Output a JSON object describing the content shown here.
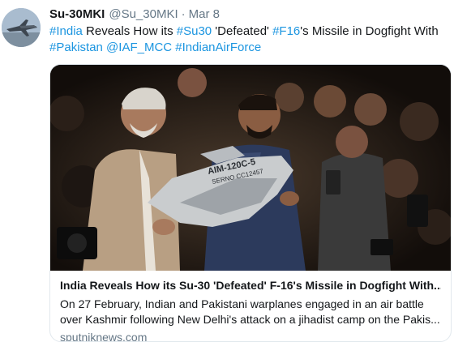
{
  "tweet": {
    "display_name": "Su-30MKI",
    "handle": "@Su_30MKI",
    "separator": "·",
    "time": "Mar 8",
    "text_segments": [
      {
        "text": "#India",
        "link": true
      },
      {
        "text": " Reveals How its ",
        "link": false
      },
      {
        "text": "#Su30",
        "link": true
      },
      {
        "text": " 'Defeated' ",
        "link": false
      },
      {
        "text": "#F16",
        "link": true
      },
      {
        "text": "'s Missile in Dogfight With ",
        "link": false
      },
      {
        "text": "#Pakistan",
        "link": true
      },
      {
        "text": " ",
        "link": false
      },
      {
        "text": "@IAF_MCC",
        "link": true
      },
      {
        "text": " ",
        "link": false
      },
      {
        "text": "#IndianAirForce",
        "link": true
      }
    ]
  },
  "card": {
    "image_text_line1": "AIM-120C-5",
    "image_text_line2": "SERNO CC12457",
    "title": "India Reveals How its Su-30 'Defeated' F-16's Missile in Dogfight With...",
    "desc_line1": "On 27 February, Indian and Pakistani warplanes engaged in an air battle",
    "desc_line2": "over Kashmir following New Delhi's attack on a jihadist camp on the Pakis...",
    "domain": "sputniknews.com"
  },
  "colors": {
    "link": "#1b95e0",
    "muted": "#657786",
    "text": "#14171a",
    "border": "#e1e8ed"
  }
}
